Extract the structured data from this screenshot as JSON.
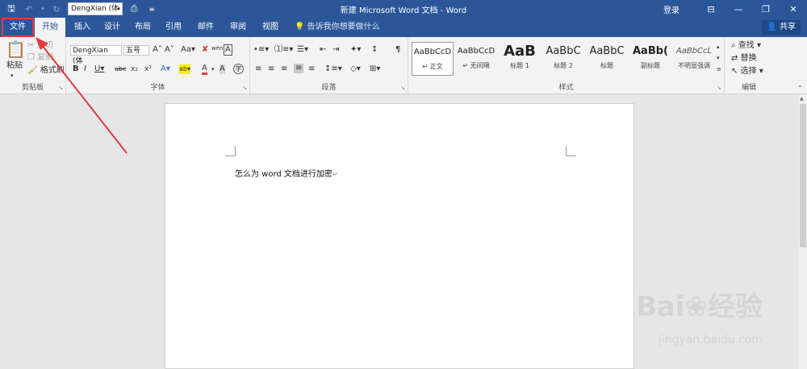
{
  "titlebar": {
    "font_name": "DengXian (体",
    "title": "新建 Microsoft Word 文档 - Word",
    "login": "登录"
  },
  "tabs": {
    "file": "文件",
    "home": "开始",
    "insert": "插入",
    "design": "设计",
    "layout": "布局",
    "references": "引用",
    "mailings": "邮件",
    "review": "审阅",
    "view": "视图",
    "tell_me": "告诉我你想要做什么",
    "share": "共享"
  },
  "clipboard": {
    "paste": "粘贴",
    "cut": "剪切",
    "copy": "复制",
    "format_painter": "格式刷",
    "label": "剪贴板"
  },
  "font": {
    "name": "DengXian (体",
    "size": "五号",
    "label": "字体"
  },
  "paragraph": {
    "label": "段落"
  },
  "styles": {
    "label": "样式",
    "items": [
      {
        "preview": "AaBbCcD",
        "name": "↵ 正文"
      },
      {
        "preview": "AaBbCcD",
        "name": "↵ 无间隔"
      },
      {
        "preview": "AaB",
        "name": "标题 1"
      },
      {
        "preview": "AaBbC",
        "name": "标题 2"
      },
      {
        "preview": "AaBbC",
        "name": "标题"
      },
      {
        "preview": "AaBb(",
        "name": "副标题"
      },
      {
        "preview": "AaBbCcL",
        "name": "不明显强调"
      }
    ]
  },
  "editing": {
    "find": "查找",
    "replace": "替换",
    "select": "选择",
    "label": "编辑"
  },
  "document": {
    "text": "怎么为 word 文档进行加密"
  },
  "watermark": {
    "brand": "Bai❀经验",
    "url": "jingyan.baidu.com"
  },
  "colors": {
    "ribbon_blue": "#2b579a",
    "highlight_red": "#e03c3c"
  }
}
